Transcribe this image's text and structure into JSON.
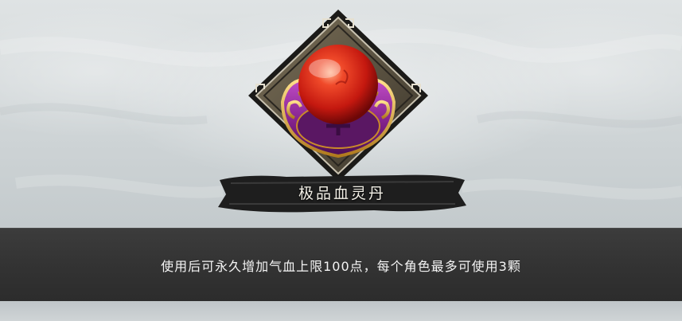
{
  "item": {
    "name": "极品血灵丹",
    "description": "使用后可永久增加气血上限100点，每个角色最多可使用3颗",
    "icon": "red-elixir-pill-icon"
  },
  "colors": {
    "pill_red": "#d8261a",
    "holder_purple": "#8a2a8e",
    "gold_trim": "#d6a33a",
    "panel_dark": "#333333"
  }
}
